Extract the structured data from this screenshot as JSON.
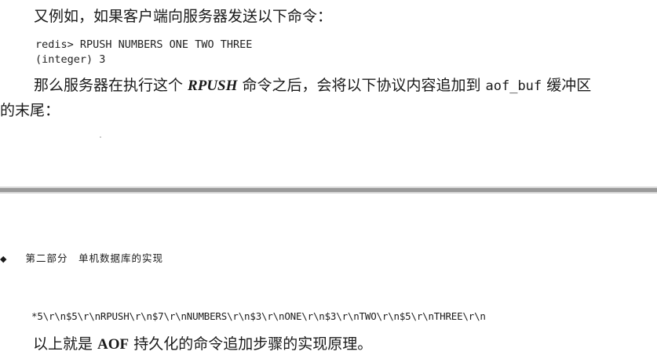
{
  "page1": {
    "intro": "又例如，如果客户端向服务器发送以下命令：",
    "code": {
      "line1": "redis> RPUSH NUMBERS ONE TWO THREE",
      "line2": "(integer) 3"
    },
    "para": {
      "part1": "那么服务器在执行这个 ",
      "cmd": "RPUSH",
      "part2": " 命令之后，会将以下协议内容追加到 ",
      "buf": "aof_buf",
      "part3": " 缓冲区",
      "line2": "的末尾："
    }
  },
  "page2": {
    "header_bullet": "◆",
    "header": "第二部分　单机数据库的实现",
    "protocol": "*5\\r\\n$5\\r\\nRPUSH\\r\\n$7\\r\\nNUMBERS\\r\\n$3\\r\\nONE\\r\\n$3\\r\\nTWO\\r\\n$5\\r\\nTHREE\\r\\n",
    "summary": {
      "part1": "以上就是 ",
      "aof": "AOF",
      "part2": " 持久化的命令追加步骤的实现原理。"
    }
  }
}
